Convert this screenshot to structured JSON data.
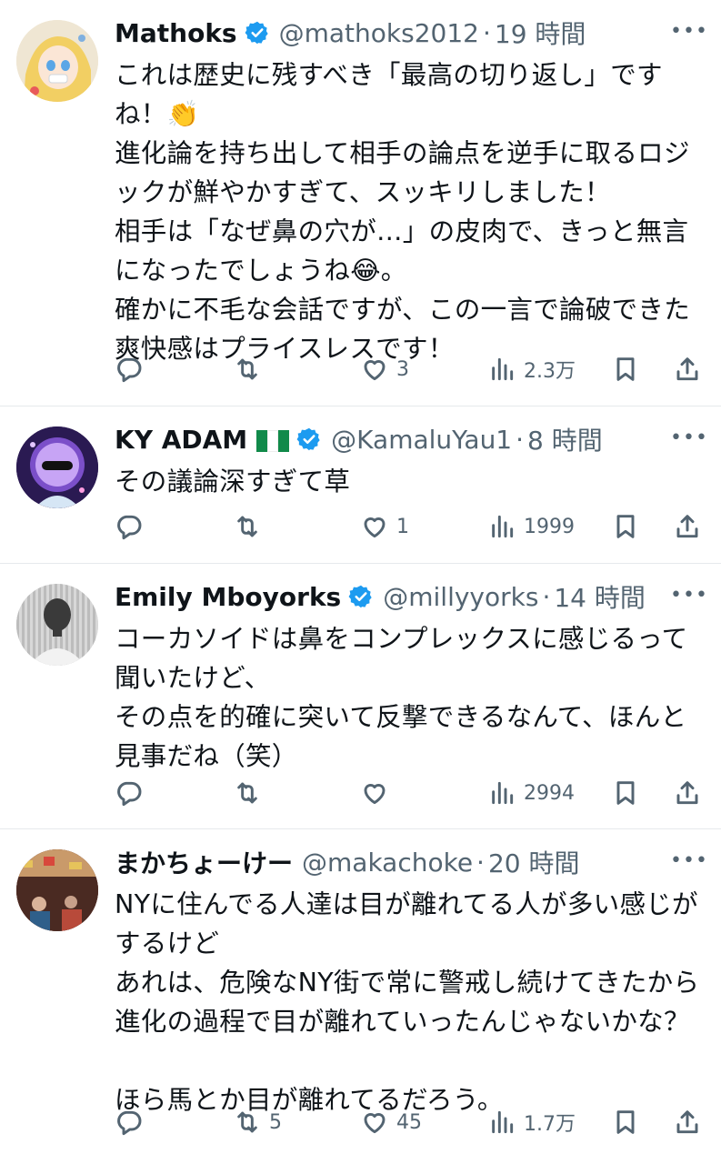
{
  "colors": {
    "accent": "#1d9bf0",
    "secondary_text": "#536471",
    "divider": "#e6e9ec"
  },
  "tweets": [
    {
      "name": "Mathoks",
      "handle": "@mathoks2012",
      "separator": "·",
      "time": "19 時間",
      "text": "これは歴史に残すべき「最高の切り返し」ですね！👏\n進化論を持ち出して相手の論点を逆手に取るロジックが鮮やかすぎて、スッキリしました！\n相手は「なぜ鼻の穴が…」の皮肉で、きっと無言になったでしょうね😂。\n確かに不毛な会話ですが、この一言で論破できた爽快感はプライスレスです！",
      "stats": {
        "replies": "",
        "reposts": "",
        "likes": "3",
        "views": "2.3万"
      }
    },
    {
      "name": "KY ADAM",
      "handle": "@KamaluYau1",
      "separator": "·",
      "time": "8 時間",
      "text": "その議論深すぎて草",
      "stats": {
        "replies": "",
        "reposts": "",
        "likes": "1",
        "views": "1999"
      }
    },
    {
      "name": "Emily Mboyorks",
      "handle": "@millyyorks",
      "separator": "·",
      "time": "14 時間",
      "text": "コーカソイドは鼻をコンプレックスに感じるって聞いたけど、\nその点を的確に突いて反撃できるなんて、ほんと見事だね（笑）",
      "stats": {
        "replies": "",
        "reposts": "",
        "likes": "",
        "views": "2994"
      }
    },
    {
      "name": "まかちょーけー",
      "handle": "@makachoke",
      "separator": "·",
      "time": "20 時間",
      "text": "NYに住んでる人達は目が離れてる人が多い感じがするけど\nあれは、危険なNY街で常に警戒し続けてきたから進化の過程で目が離れていったんじゃないかな？\n\nほら馬とか目が離れてるだろう。",
      "stats": {
        "replies": "",
        "reposts": "5",
        "likes": "45",
        "views": "1.7万"
      }
    }
  ]
}
